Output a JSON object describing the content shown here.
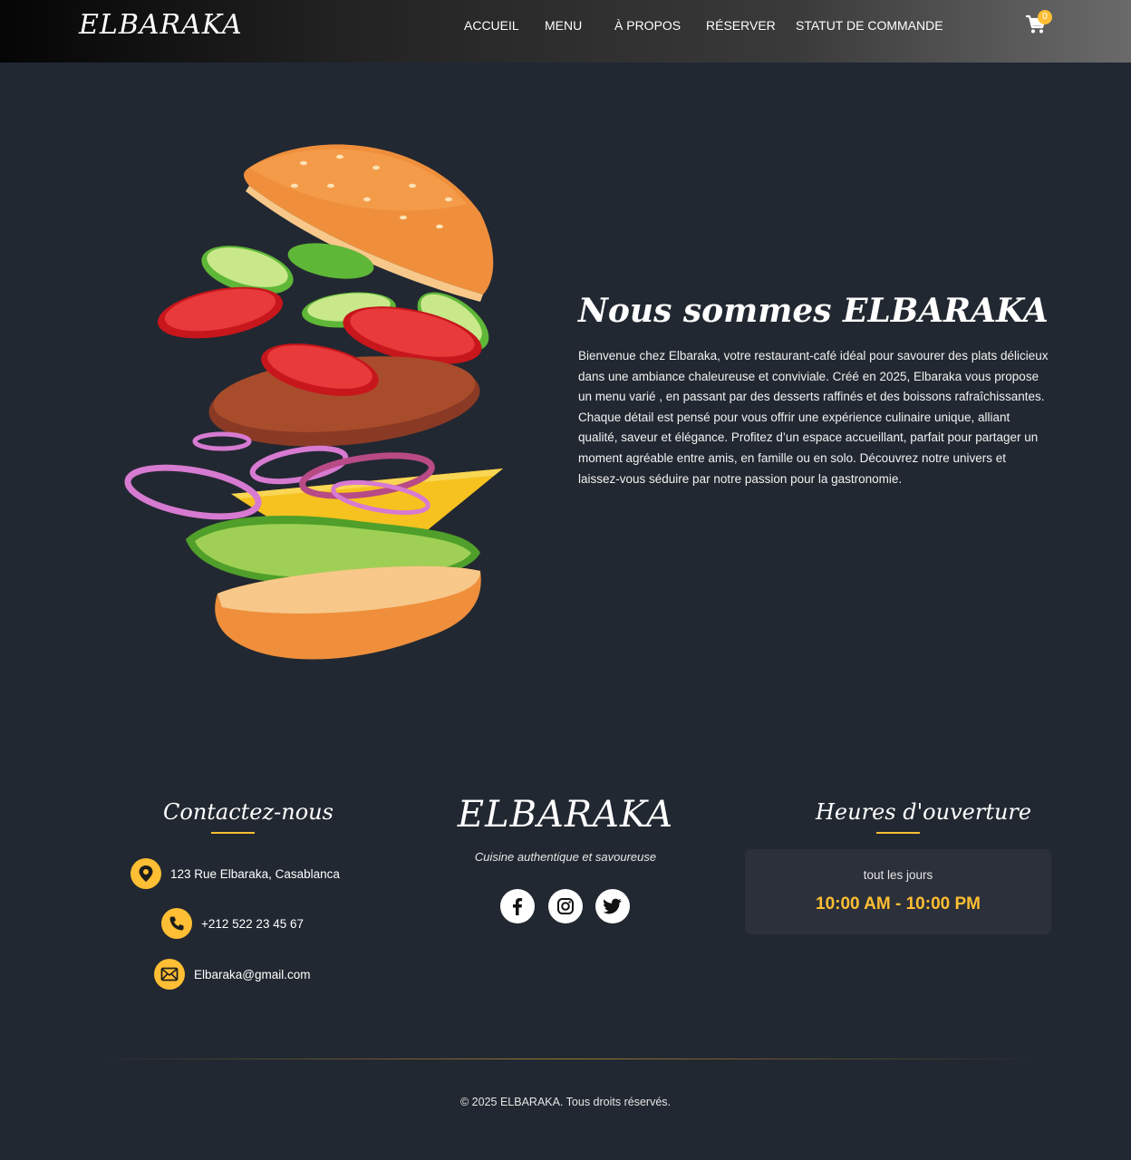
{
  "header": {
    "logo": "ELBARAKA",
    "nav": [
      "ACCUEIL",
      "MENU",
      "À PROPOS",
      "RÉSERVER",
      "STATUT DE COMMANDE"
    ],
    "cart_count": "0",
    "cart_icon": "cart-icon"
  },
  "about": {
    "image": "burger-illustration",
    "title": "Nous sommes ELBARAKA",
    "text": "Bienvenue chez Elbaraka, votre restaurant-café idéal pour savourer des plats délicieux dans une ambiance chaleureuse et conviviale. Créé en 2025, Elbaraka vous propose un menu varié , en passant par des desserts raffinés et des boissons rafraîchissantes. Chaque détail est pensé pour vous offrir une expérience culinaire unique, alliant qualité, saveur et élégance. Profitez d’un espace accueillant, parfait pour partager un moment agréable entre amis, en famille ou en solo. Découvrez notre univers et laissez-vous séduire par notre passion pour la gastronomie."
  },
  "footer": {
    "contact": {
      "title": "Contactez-nous",
      "address": "123 Rue Elbaraka, Casablanca",
      "phone": "+212 522 23 45 67",
      "email": "Elbaraka@gmail.com"
    },
    "brand": {
      "name": "ELBARAKA",
      "tagline": "Cuisine authentique et savoureuse",
      "social": [
        "facebook-icon",
        "instagram-icon",
        "twitter-icon"
      ]
    },
    "hours": {
      "title": "Heures d'ouverture",
      "days": "tout les jours",
      "time": "10:00 AM - 10:00 PM"
    },
    "copyright": "© 2025 ELBARAKA. Tous droits réservés."
  },
  "colors": {
    "background": "#222831",
    "accent": "#ffbe33",
    "card": "#2b303a"
  }
}
